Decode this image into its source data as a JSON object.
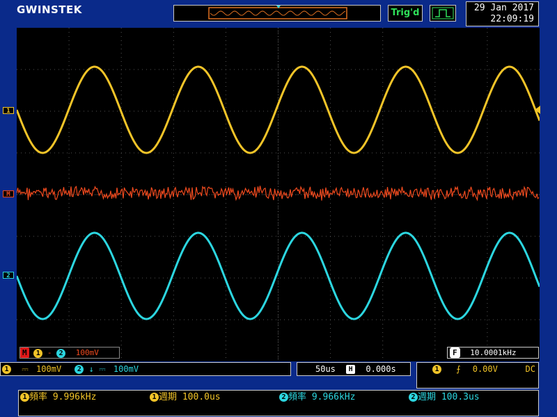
{
  "brand": "GWINSTEK",
  "trigger": {
    "status": "Trig'd",
    "type_icon": "pulse-edge-icon"
  },
  "datetime": {
    "date": "29 Jan 2017",
    "time": "22:09:19"
  },
  "markers": {
    "ch1": "1",
    "math": "M",
    "ch2": "2"
  },
  "math_info": {
    "badge": "M",
    "src1": "1",
    "op": "-",
    "src2": "2",
    "scale": "100mV"
  },
  "trigger_freq": {
    "badge": "F",
    "value": "10.0001kHz"
  },
  "channels": [
    {
      "num": "1",
      "coupling": "DC",
      "scale": "100mV",
      "color": "#f2c428"
    },
    {
      "num": "2",
      "coupling": "DC",
      "scale": "100mV",
      "color": "#2cd6e0",
      "inverted": true
    }
  ],
  "timebase": {
    "scale": "50us",
    "position": "0.000s"
  },
  "trigger_settings": {
    "source": "1",
    "slope": "rising",
    "level": "0.00V",
    "coupling": "DC"
  },
  "measurements": [
    {
      "ch": "1",
      "label": "頻率",
      "value": "9.996kHz"
    },
    {
      "ch": "1",
      "label": "週期",
      "value": "100.0us"
    },
    {
      "ch": "2",
      "label": "頻率",
      "value": "9.966kHz"
    },
    {
      "ch": "2",
      "label": "週期",
      "value": "100.3us"
    }
  ],
  "colors": {
    "ch1": "#f2c428",
    "ch2": "#2cd6e0",
    "math": "#f04a1e",
    "background": "#0a2a8a"
  }
}
